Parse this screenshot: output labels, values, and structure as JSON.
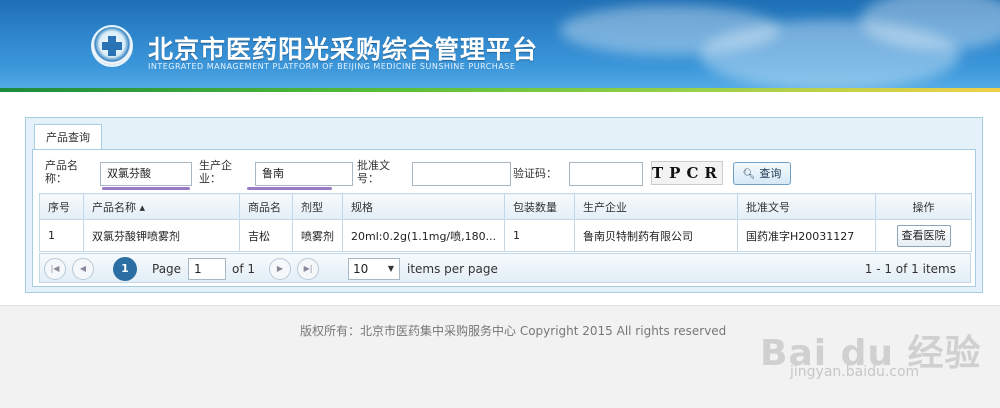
{
  "header": {
    "title": "北京市医药阳光采购综合管理平台",
    "subtitle": "INTEGRATED MANAGEMENT PLATFORM OF BEIJING MEDICINE SUNSHINE PURCHASE"
  },
  "tab": {
    "label": "产品查询"
  },
  "search": {
    "product_name_label": "产品名称：",
    "product_name_value": "双氯芬酸",
    "manufacturer_label": "生产企业：",
    "manufacturer_value": "鲁南",
    "approval_label": "批准文号：",
    "approval_value": "",
    "captcha_label": "验证码：",
    "captcha_value": "",
    "captcha_image_text": "TPCR",
    "query_button": "查询"
  },
  "table": {
    "columns": [
      "序号",
      "产品名称",
      "商品名",
      "剂型",
      "规格",
      "包装数量",
      "生产企业",
      "批准文号",
      "操作"
    ],
    "sort_indicator": "▴",
    "rows": [
      {
        "index": "1",
        "product_name": "双氯芬酸钾喷雾剂",
        "trade_name": "吉松",
        "dosage_form": "喷雾剂",
        "spec": "20ml:0.2g(1.1mg/喷,180...",
        "pack_qty": "1",
        "manufacturer": "鲁南贝特制药有限公司",
        "approval_no": "国药准字H20031127",
        "action": "查看医院"
      }
    ]
  },
  "pager": {
    "current_page": "1",
    "page_label": "Page",
    "page_input": "1",
    "of_label": "of 1",
    "page_size": "10",
    "items_per_page": "items per page",
    "summary": "1 - 1 of 1 items"
  },
  "footer": {
    "copyright": "版权所有：北京市医药集中采购服务中心 Copyright 2015 All rights reserved",
    "watermark": "Bai du 经验",
    "watermark_sub": "jingyan.baidu.com"
  },
  "colors": {
    "banner": "#2f86cc",
    "accent": "#2a6ea4",
    "underline": "#9a7bc6"
  }
}
